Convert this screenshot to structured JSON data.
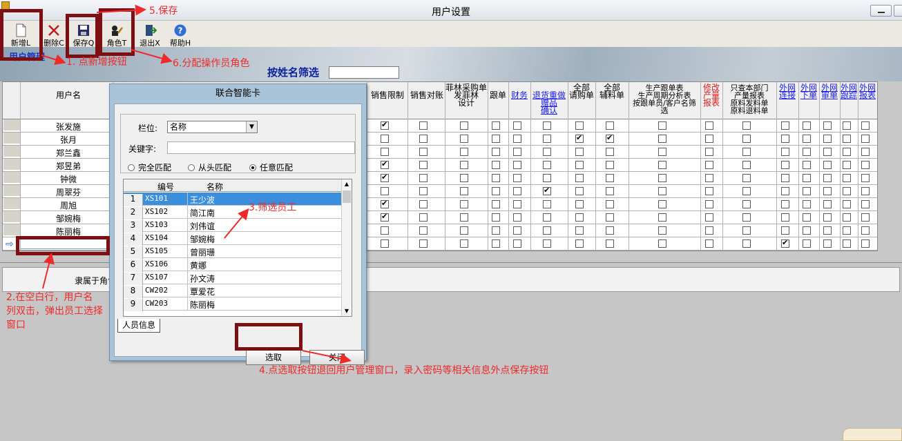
{
  "window": {
    "title": "用户设置"
  },
  "toolbar": {
    "items": [
      {
        "label": "新增L"
      },
      {
        "label": "删除C"
      },
      {
        "label": "保存Q"
      },
      {
        "label": "角色T"
      },
      {
        "label": "退出X"
      },
      {
        "label": "帮助H"
      }
    ]
  },
  "module": {
    "title": "用户管理"
  },
  "filter": {
    "label": "按姓名筛选",
    "value": ""
  },
  "grid": {
    "headers": {
      "username": "用户名",
      "sales_limit": "销售限制",
      "sales_reconcile": "销售对账",
      "feilin": "菲林采购单\n发菲林\n设计",
      "follow": "跟单",
      "finance": "财务",
      "return": "退货重做\n赠品\n确认",
      "all_purchase": "全部\n请购单",
      "all_aux": "全部\n辅料单",
      "report": "生产跟单表\n生产周期分析表\n按跟单员/客户名筛\n选",
      "modify": "修改\n产量\n报表",
      "dept_only": "只查本部门\n产量报表\n原料发料单\n原料退料单",
      "ext_connect": "外网\n连接",
      "ext_order": "外网\n下单",
      "ext_audit": "外网\n审单",
      "ext_follow": "外网\n跟踪",
      "ext_report": "外网\n报表"
    },
    "rows": [
      {
        "name": "张发施",
        "checks": [
          1,
          0,
          0,
          0,
          0,
          0,
          0,
          0,
          0,
          0,
          0,
          0,
          0,
          0,
          0,
          0
        ]
      },
      {
        "name": "张月",
        "checks": [
          0,
          0,
          0,
          0,
          0,
          0,
          1,
          1,
          0,
          0,
          0,
          0,
          0,
          0,
          0,
          0
        ]
      },
      {
        "name": "郑兰鑫",
        "checks": [
          0,
          0,
          0,
          0,
          0,
          0,
          0,
          0,
          0,
          0,
          0,
          0,
          0,
          0,
          0,
          0
        ]
      },
      {
        "name": "郑昱弟",
        "checks": [
          1,
          0,
          0,
          0,
          0,
          0,
          0,
          0,
          0,
          0,
          0,
          0,
          0,
          0,
          0,
          0
        ]
      },
      {
        "name": "钟微",
        "checks": [
          1,
          0,
          0,
          0,
          0,
          0,
          0,
          0,
          0,
          0,
          0,
          0,
          0,
          0,
          0,
          0
        ]
      },
      {
        "name": "周翠芬",
        "checks": [
          0,
          0,
          0,
          0,
          0,
          1,
          0,
          0,
          0,
          0,
          0,
          0,
          0,
          0,
          0,
          0
        ]
      },
      {
        "name": "周旭",
        "checks": [
          1,
          0,
          0,
          0,
          0,
          0,
          0,
          0,
          0,
          0,
          0,
          0,
          0,
          0,
          0,
          0
        ]
      },
      {
        "name": "邹婉梅",
        "checks": [
          1,
          0,
          0,
          0,
          0,
          0,
          0,
          0,
          0,
          0,
          0,
          0,
          0,
          0,
          0,
          0
        ]
      },
      {
        "name": "陈丽梅",
        "checks": [
          0,
          0,
          0,
          0,
          0,
          0,
          0,
          0,
          0,
          0,
          0,
          0,
          0,
          0,
          0,
          0
        ]
      },
      {
        "name": "",
        "checks": [
          0,
          0,
          0,
          0,
          0,
          0,
          0,
          0,
          0,
          0,
          0,
          1,
          0,
          0,
          0,
          0
        ]
      }
    ]
  },
  "lower": {
    "role_header": "隶属于角色"
  },
  "dialog": {
    "title": "联合智能卡",
    "field_label": "栏位:",
    "field_value": "名称",
    "keyword_label": "关键字:",
    "keyword_value": "",
    "radios": [
      {
        "label": "完全匹配",
        "checked": false
      },
      {
        "label": "从头匹配",
        "checked": false
      },
      {
        "label": "任意匹配",
        "checked": true
      }
    ],
    "columns": {
      "code": "编号",
      "name": "名称"
    },
    "employees": [
      {
        "n": "1",
        "code": "XS101",
        "name": "王少波"
      },
      {
        "n": "2",
        "code": "XS102",
        "name": "简江南"
      },
      {
        "n": "3",
        "code": "XS103",
        "name": "刘伟谊"
      },
      {
        "n": "4",
        "code": "XS104",
        "name": "邹婉梅"
      },
      {
        "n": "5",
        "code": "XS105",
        "name": "曾丽珊"
      },
      {
        "n": "6",
        "code": "XS106",
        "name": "黄娜"
      },
      {
        "n": "7",
        "code": "XS107",
        "name": "孙文涛"
      },
      {
        "n": "8",
        "code": "CW202",
        "name": "覃爱花"
      },
      {
        "n": "9",
        "code": "CW203",
        "name": "陈丽梅"
      }
    ],
    "selected_row": 1,
    "tab": "人员信息",
    "select_button": "选取",
    "close_button": "关闭"
  },
  "annotations": {
    "step1": "1. 点新增按钮",
    "step2": "2.在空白行，用户名\n列双击，弹出员工选择\n窗口",
    "step3": "3.筛选员工",
    "step4": "4.点选取按钮退回用户管理窗口，录入密码等相关信息外点保存按钮",
    "step5": "5.保存",
    "step6": "6.分配操作员角色"
  },
  "colors": {
    "annotation": "#ee2a2a",
    "highlight_box": "#7d0f12",
    "selection": "#3b8edb",
    "link_header": "#1a1af0"
  }
}
